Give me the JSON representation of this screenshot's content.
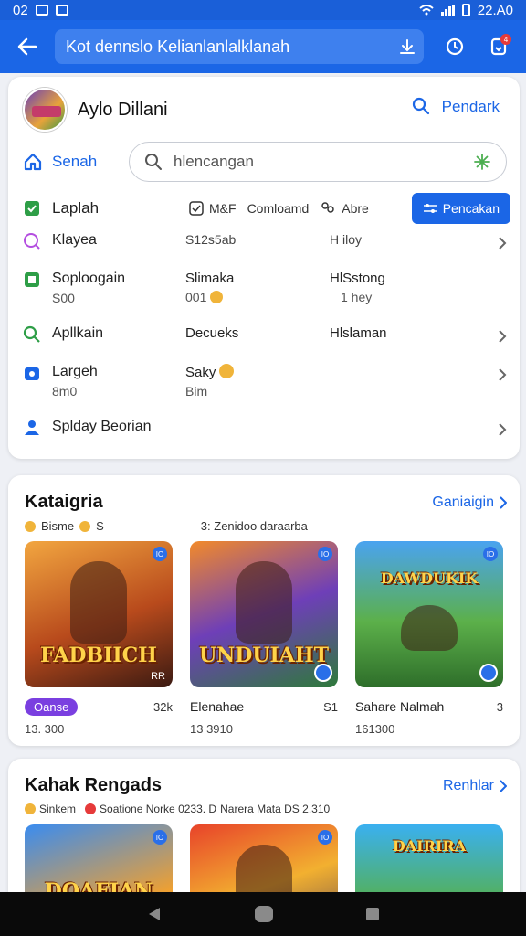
{
  "status": {
    "left": "02",
    "time": "22.A0"
  },
  "appbar": {
    "url": "Kot dennslo Kelianlanlalklanah",
    "badge": "4"
  },
  "profile": {
    "name": "Aylo Dillani",
    "link": "Pendark"
  },
  "home": {
    "label": "Senah",
    "search_placeholder": "hlencangan"
  },
  "filters": {
    "first": "Laplah",
    "chips": [
      "M&F",
      "Comloamd",
      "Abre",
      "Pencakan"
    ]
  },
  "rows": [
    {
      "c1": "Klayea",
      "c1_sub": "",
      "c2": "S12s5ab",
      "c2_sub": "",
      "c3": "H iloy",
      "c3_sub": ""
    },
    {
      "c1": "Soploogain",
      "c1_sub": "S00",
      "c2": "Slimaka",
      "c2_sub": "001",
      "c3": "HlSstong",
      "c3_sub": "1 hey"
    },
    {
      "c1": "Apllkain",
      "c1_sub": "",
      "c2": "Decueks",
      "c2_sub": "",
      "c3": "Hlslaman",
      "c3_sub": ""
    },
    {
      "c1": "Largeh",
      "c1_sub": "8m0",
      "c2": "Saky",
      "c2_sub": "Bim",
      "c3": "",
      "c3_sub": ""
    },
    {
      "c1": "Splday Beorian",
      "c1_sub": "",
      "c2": "",
      "c2_sub": "",
      "c3": "",
      "c3_sub": ""
    }
  ],
  "section1": {
    "title": "Kataigria",
    "link": "Ganiaigin",
    "sub_a": "Bisme",
    "sub_b": "S",
    "sub_c": "3: Zenidoo daraarba",
    "games": [
      {
        "art": "FADBIICH",
        "corner": "IO",
        "tag": "Oanse",
        "num": "32k",
        "sub": "13. 300",
        "br": "RR"
      },
      {
        "art": "UNDUIAHT",
        "corner": "IO",
        "tag": "Elenahae",
        "num": "S1",
        "sub": "13 3910",
        "br": ""
      },
      {
        "art": "DAWDUKIK",
        "corner": "IO",
        "tag": "Sahare Nalmah",
        "num": "3",
        "sub": "161300",
        "br": ""
      }
    ]
  },
  "section2": {
    "title": "Kahak Rengads",
    "link": "Renhlar",
    "sub": "Sinkem",
    "sub2": "Soatione Norke 0233. D",
    "sub3": "Narera Mata DS 2.310",
    "games": [
      {
        "art": "DOAFIAN",
        "corner": "IO"
      },
      {
        "art": "",
        "corner": "IO"
      },
      {
        "art": "DAIRIRA",
        "corner": ""
      }
    ]
  },
  "colors": {
    "primary": "#1b66e6",
    "pill": "#7a3fe0"
  }
}
